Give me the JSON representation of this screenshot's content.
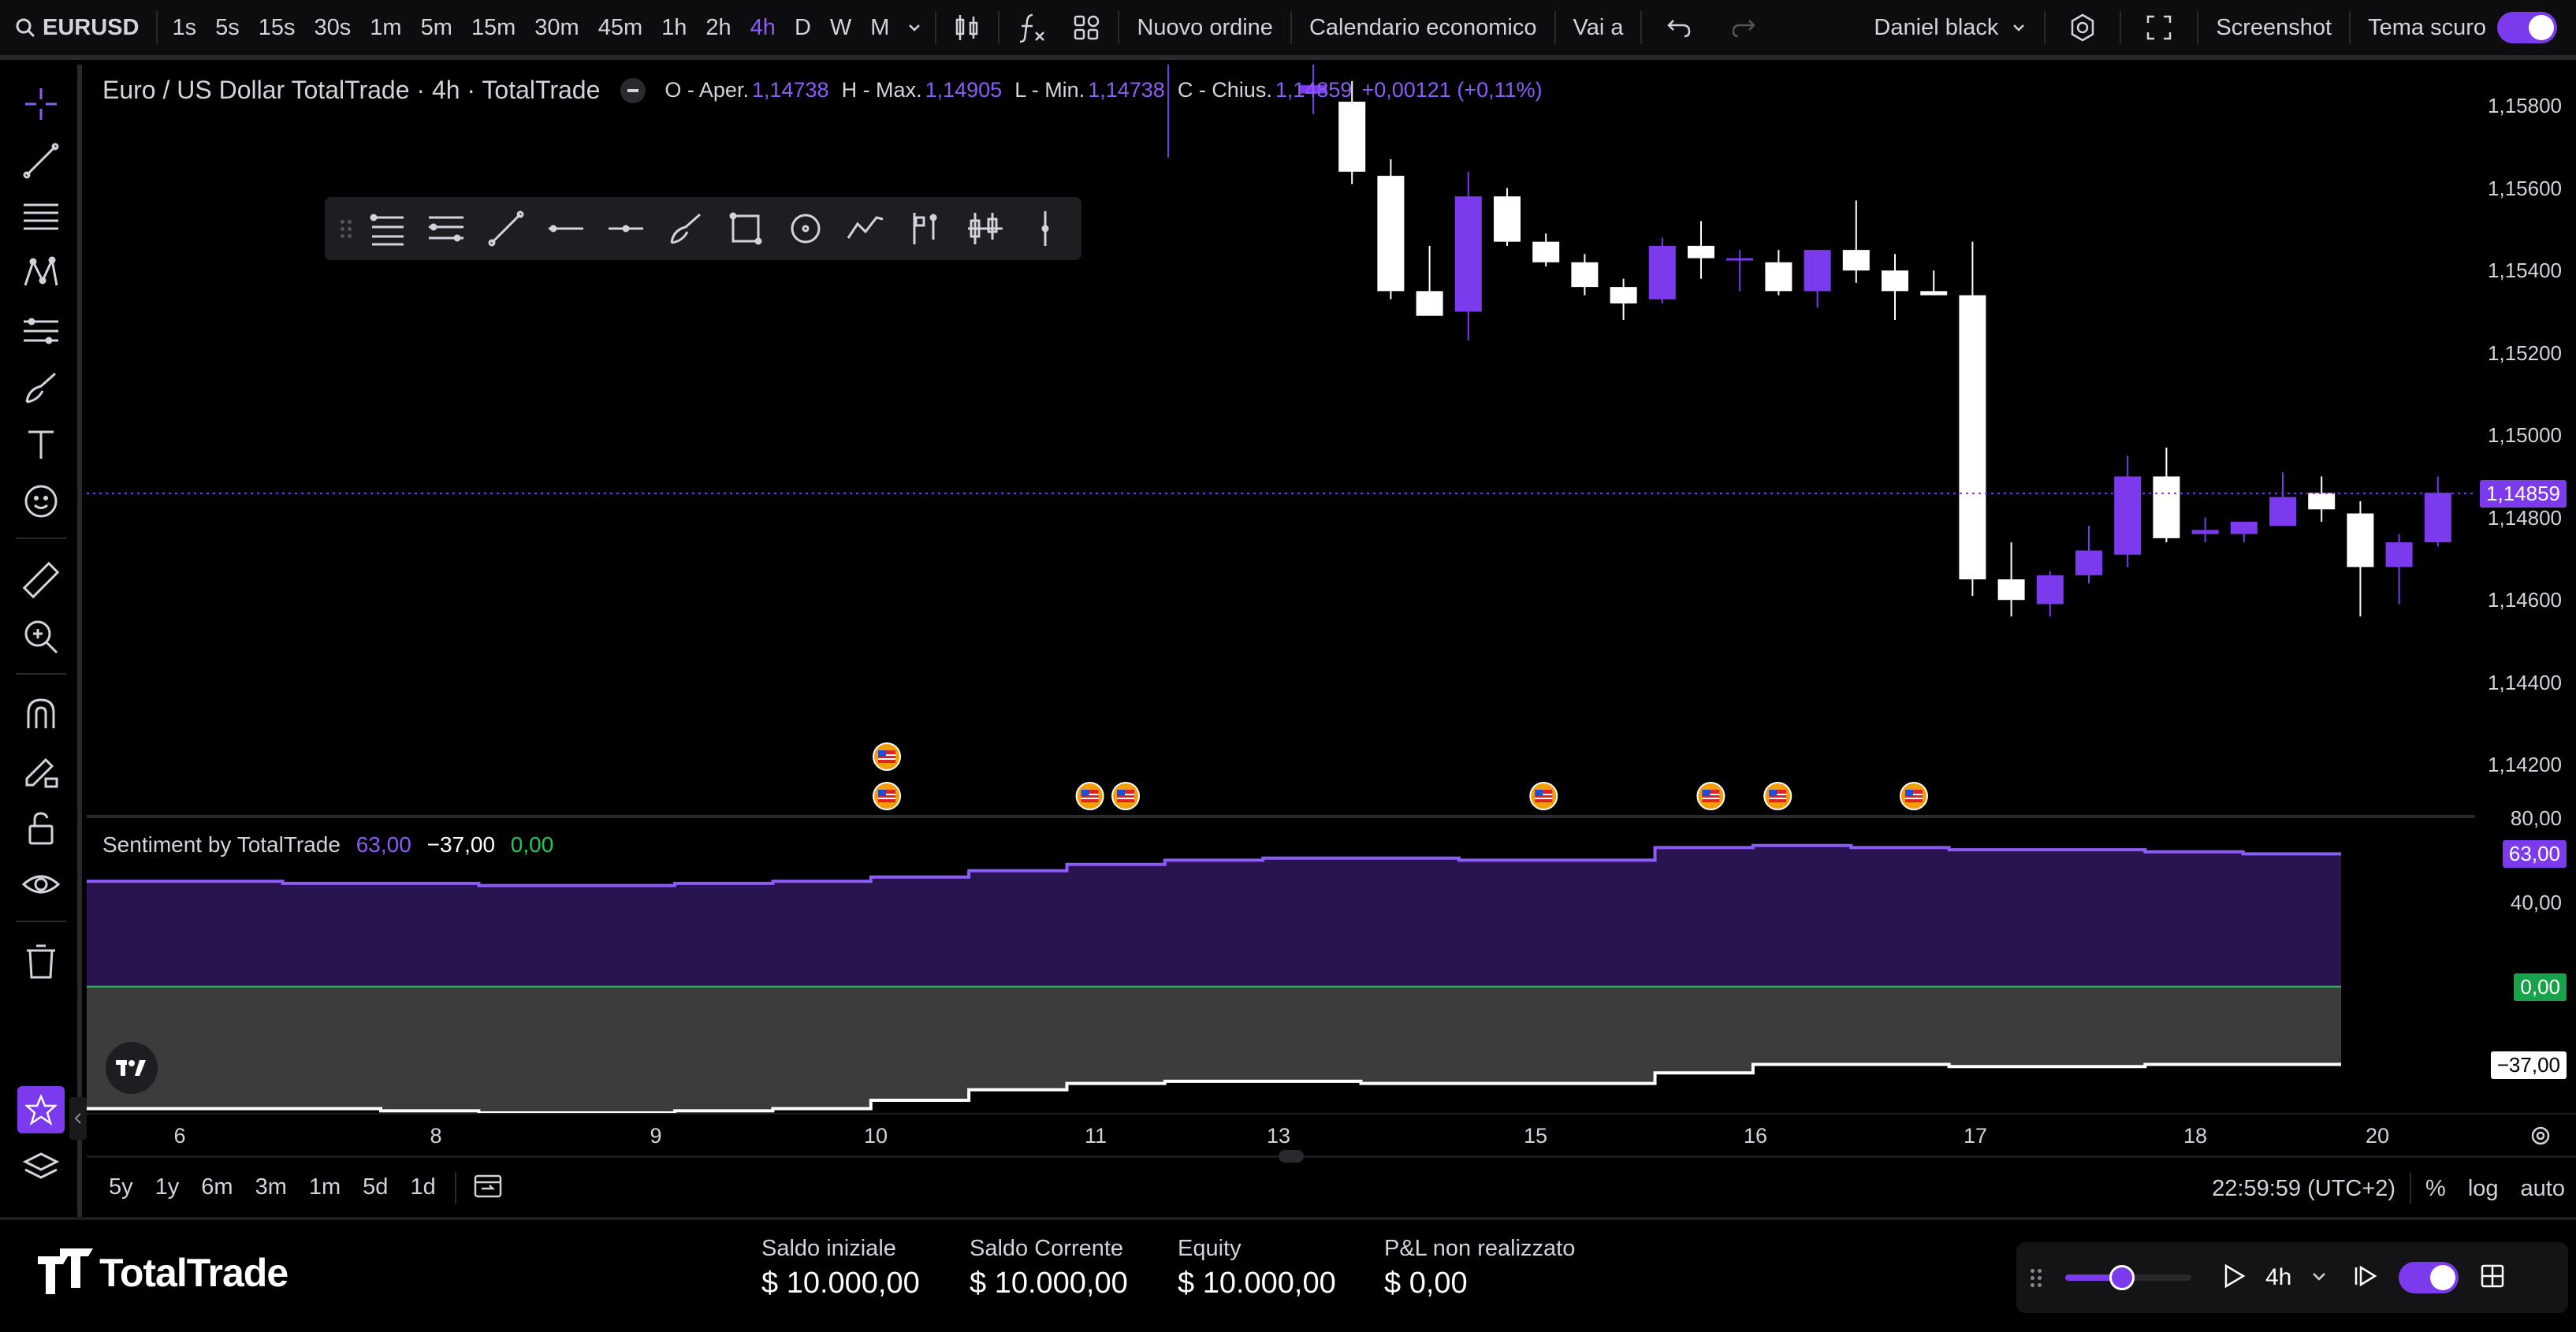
{
  "topbar": {
    "symbol": "EURUSD",
    "intervals": [
      "1s",
      "5s",
      "15s",
      "30s",
      "1m",
      "5m",
      "15m",
      "30m",
      "45m",
      "1h",
      "2h",
      "4h",
      "D",
      "W",
      "M"
    ],
    "active_interval": "4h",
    "new_order": "Nuovo ordine",
    "calendar": "Calendario economico",
    "goto": "Vai a",
    "user": "Daniel black",
    "screenshot": "Screenshot",
    "dark_theme": "Tema scuro"
  },
  "legend": {
    "title": "Euro / US Dollar TotalTrade · 4h · TotalTrade",
    "open_label": "O - Aper.",
    "open": "1,14738",
    "high_label": "H - Max.",
    "high": "1,14905",
    "low_label": "L - Min.",
    "low": "1,14738",
    "close_label": "C - Chius.",
    "close": "1,14859",
    "change": "+0,00121 (+0,11%)"
  },
  "price_axis": {
    "labels": [
      "1,15800",
      "1,15600",
      "1,15400",
      "1,15200",
      "1,15000",
      "1,14800",
      "1,14600",
      "1,14400",
      "1,14200"
    ],
    "last_price": "1,14859",
    "sentiment_labels": [
      "80,00",
      "40,00"
    ],
    "sentiment_positive": "63,00",
    "sentiment_zero": "0,00",
    "sentiment_negative": "−37,00"
  },
  "sentiment": {
    "name": "Sentiment by TotalTrade",
    "v1": "63,00",
    "v2": "−37,00",
    "v3": "0,00"
  },
  "time_axis": [
    "6",
    "8",
    "9",
    "10",
    "11",
    "13",
    "15",
    "16",
    "17",
    "18",
    "20"
  ],
  "rangebar": {
    "ranges": [
      "5y",
      "1y",
      "6m",
      "3m",
      "1m",
      "5d",
      "1d"
    ],
    "clock": "22:59:59 (UTC+2)",
    "pct": "%",
    "log": "log",
    "auto": "auto"
  },
  "footer": {
    "brand": "TotalTrade",
    "saldo_iniziale_label": "Saldo iniziale",
    "saldo_iniziale": "$ 10.000,00",
    "saldo_corrente_label": "Saldo Corrente",
    "saldo_corrente": "$ 10.000,00",
    "equity_label": "Equity",
    "equity": "$ 10.000,00",
    "pnl_label": "P&L non realizzato",
    "pnl": "$ 0,00",
    "replay_interval": "4h",
    "replay_speed": 0.45
  },
  "colors": {
    "accent": "#7c3aed",
    "bull": "#7c3aed",
    "bear": "#ffffff",
    "sentiment_pos_fill": "#2a1450",
    "sentiment_neg_fill": "#3c3c3c",
    "zero_line": "#22c55e"
  },
  "chart_data": {
    "type": "candlestick",
    "symbol": "EURUSD",
    "interval": "4h",
    "ylim": [
      1.1412,
      1.159
    ],
    "candles": [
      {
        "o": 1.1583,
        "h": 1.159,
        "l": 1.1578,
        "c": 1.1585
      },
      {
        "o": 1.1581,
        "h": 1.1586,
        "l": 1.1561,
        "c": 1.1564
      },
      {
        "o": 1.1563,
        "h": 1.1567,
        "l": 1.1533,
        "c": 1.1535
      },
      {
        "o": 1.1535,
        "h": 1.1546,
        "l": 1.153,
        "c": 1.1529
      },
      {
        "o": 1.153,
        "h": 1.1564,
        "l": 1.1523,
        "c": 1.1558
      },
      {
        "o": 1.1558,
        "h": 1.156,
        "l": 1.1546,
        "c": 1.1547
      },
      {
        "o": 1.1547,
        "h": 1.1549,
        "l": 1.1541,
        "c": 1.1542
      },
      {
        "o": 1.1542,
        "h": 1.1544,
        "l": 1.1534,
        "c": 1.1536
      },
      {
        "o": 1.1536,
        "h": 1.1538,
        "l": 1.1528,
        "c": 1.1532
      },
      {
        "o": 1.1533,
        "h": 1.1548,
        "l": 1.1532,
        "c": 1.1546
      },
      {
        "o": 1.1546,
        "h": 1.1552,
        "l": 1.1538,
        "c": 1.1543
      },
      {
        "o": 1.1543,
        "h": 1.1545,
        "l": 1.1535,
        "c": 1.1543
      },
      {
        "o": 1.1542,
        "h": 1.1545,
        "l": 1.1534,
        "c": 1.1535
      },
      {
        "o": 1.1535,
        "h": 1.1545,
        "l": 1.1531,
        "c": 1.1545
      },
      {
        "o": 1.1545,
        "h": 1.1557,
        "l": 1.1537,
        "c": 1.154
      },
      {
        "o": 1.154,
        "h": 1.1544,
        "l": 1.1528,
        "c": 1.1535
      },
      {
        "o": 1.1535,
        "h": 1.154,
        "l": 1.1534,
        "c": 1.1534
      },
      {
        "o": 1.1534,
        "h": 1.1547,
        "l": 1.1461,
        "c": 1.1465
      },
      {
        "o": 1.1465,
        "h": 1.1474,
        "l": 1.1456,
        "c": 1.146
      },
      {
        "o": 1.1459,
        "h": 1.1467,
        "l": 1.1456,
        "c": 1.1466
      },
      {
        "o": 1.1466,
        "h": 1.1478,
        "l": 1.1464,
        "c": 1.1472
      },
      {
        "o": 1.1471,
        "h": 1.1495,
        "l": 1.1468,
        "c": 1.149
      },
      {
        "o": 1.149,
        "h": 1.1497,
        "l": 1.1474,
        "c": 1.1475
      },
      {
        "o": 1.1476,
        "h": 1.148,
        "l": 1.1474,
        "c": 1.1477
      },
      {
        "o": 1.1476,
        "h": 1.1479,
        "l": 1.1474,
        "c": 1.1479
      },
      {
        "o": 1.1478,
        "h": 1.1491,
        "l": 1.1478,
        "c": 1.1485
      },
      {
        "o": 1.1486,
        "h": 1.149,
        "l": 1.1479,
        "c": 1.1482
      },
      {
        "o": 1.1481,
        "h": 1.1484,
        "l": 1.1456,
        "c": 1.1468
      },
      {
        "o": 1.1468,
        "h": 1.1476,
        "l": 1.1459,
        "c": 1.1474
      },
      {
        "o": 1.1474,
        "h": 1.149,
        "l": 1.1473,
        "c": 1.1486
      }
    ],
    "sentiment": {
      "ylim": [
        -60,
        80
      ],
      "positive_final": 63,
      "negative_final": -37,
      "positive": [
        50,
        50,
        49,
        49,
        48,
        48,
        49,
        50,
        52,
        55,
        58,
        60,
        61,
        61,
        60,
        60,
        66,
        67,
        66,
        65,
        65,
        64,
        63
      ],
      "negative": [
        -58,
        -58,
        -58,
        -59,
        -60,
        -60,
        -59,
        -58,
        -54,
        -49,
        -46,
        -45,
        -45,
        -46,
        -46,
        -46,
        -41,
        -37,
        -37,
        -38,
        -38,
        -37,
        -37
      ]
    },
    "event_markers": [
      0.335,
      0.42,
      0.435,
      0.61,
      0.68,
      0.708,
      0.765
    ]
  }
}
